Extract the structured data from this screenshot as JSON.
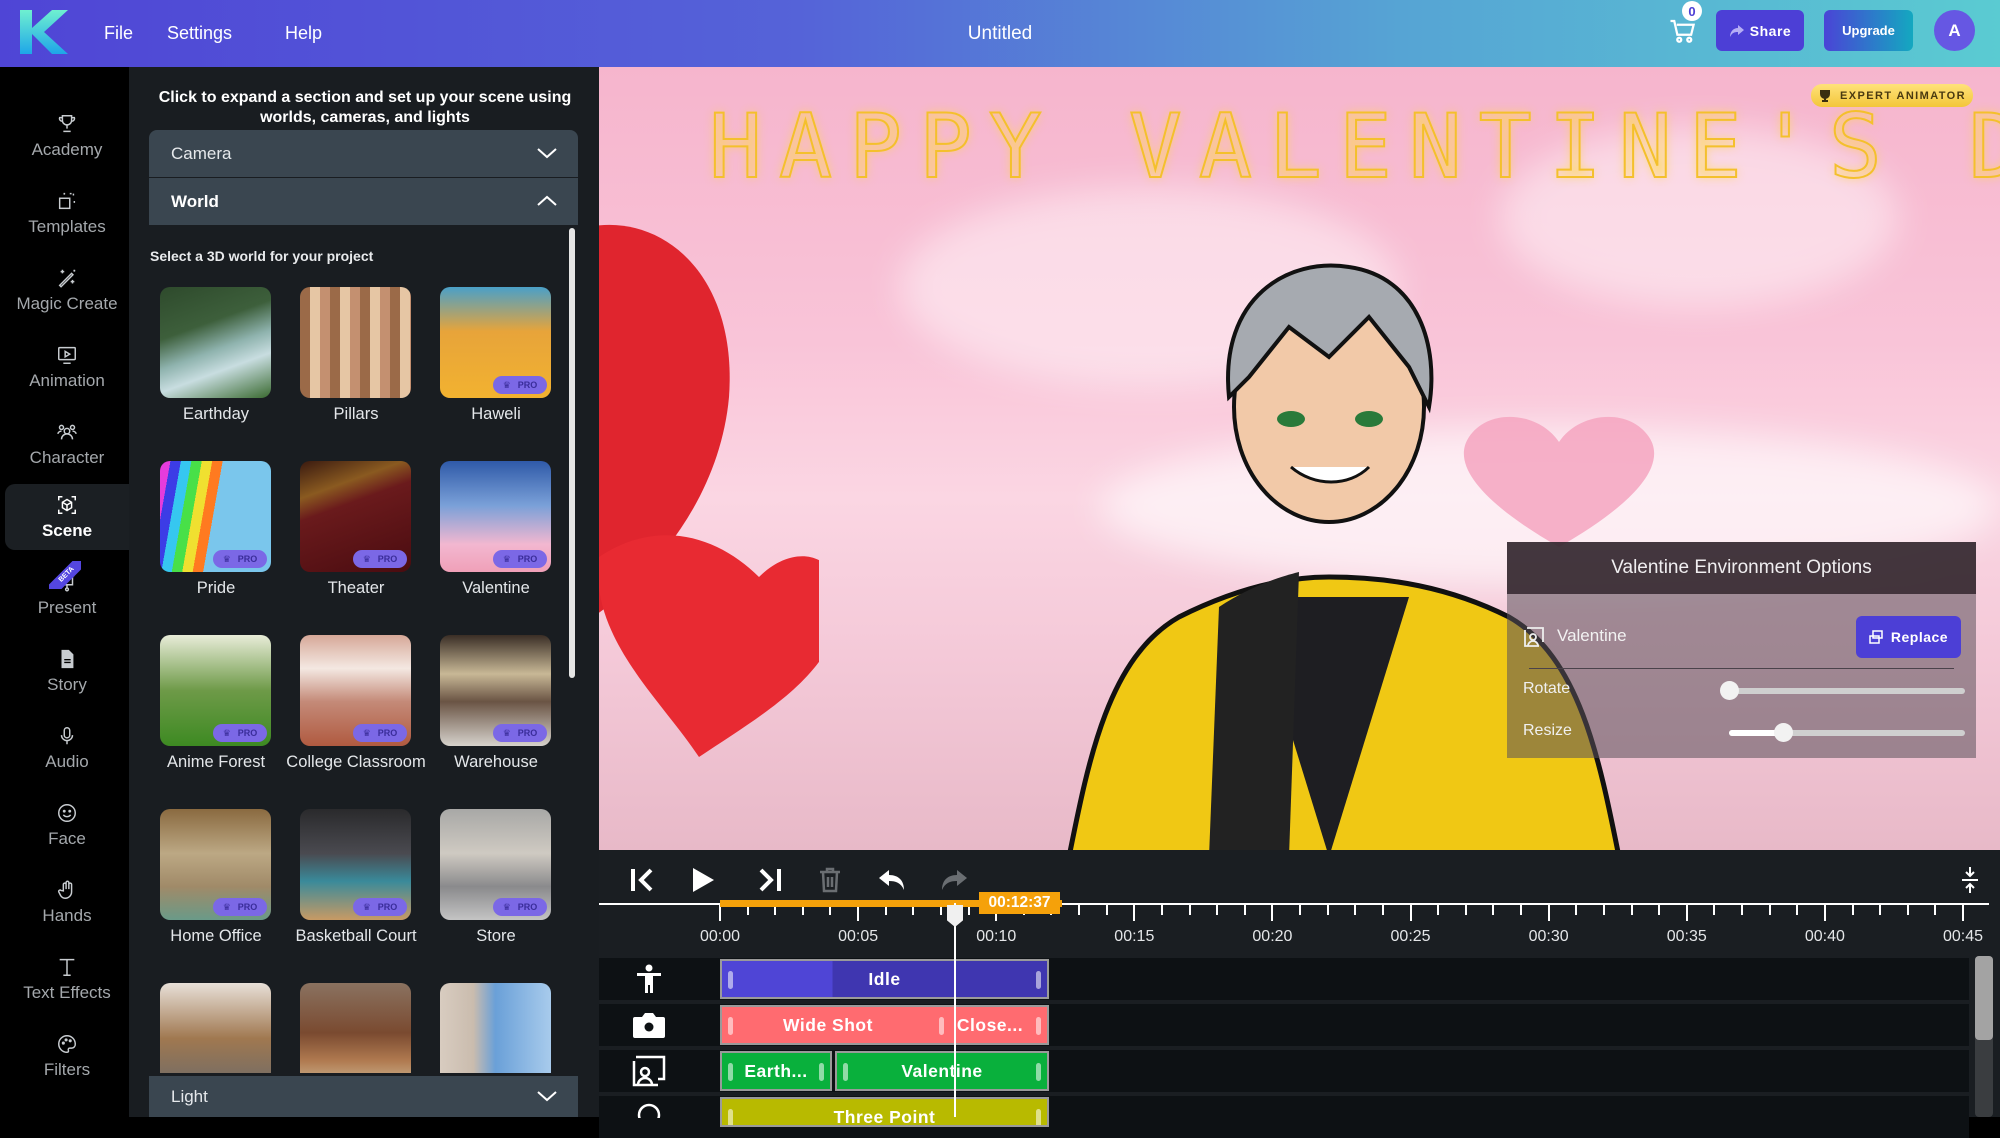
{
  "topbar": {
    "menu": [
      "File",
      "Settings",
      "Help"
    ],
    "title": "Untitled",
    "cart_count": "0",
    "share_label": "Share",
    "upgrade_label": "Upgrade",
    "avatar_initial": "A",
    "brand_color": "#4c3fd6"
  },
  "sidebar": {
    "items": [
      {
        "label": "Academy",
        "icon": "trophy-icon"
      },
      {
        "label": "Templates",
        "icon": "templates-icon"
      },
      {
        "label": "Magic Create",
        "icon": "magic-wand-icon"
      },
      {
        "label": "Animation",
        "icon": "animation-play-icon"
      },
      {
        "label": "Character",
        "icon": "characters-icon"
      },
      {
        "label": "Scene",
        "icon": "scene-cube-icon",
        "active": true
      },
      {
        "label": "Present",
        "icon": "presentation-icon",
        "badge": "BETA"
      },
      {
        "label": "Story",
        "icon": "document-icon"
      },
      {
        "label": "Audio",
        "icon": "microphone-icon"
      },
      {
        "label": "Face",
        "icon": "smiley-face-icon"
      },
      {
        "label": "Hands",
        "icon": "hand-icon"
      },
      {
        "label": "Text Effects",
        "icon": "text-icon"
      },
      {
        "label": "Filters",
        "icon": "palette-icon"
      }
    ]
  },
  "panel": {
    "hint": "Click to expand a section and set up your scene using worlds, cameras, and lights",
    "sections": {
      "camera": "Camera",
      "world": "World",
      "light": "Light"
    },
    "world_subtitle": "Select a 3D world for your project",
    "pro_label": "PRO",
    "worlds": [
      {
        "name": "Earthday",
        "pro": false
      },
      {
        "name": "Pillars",
        "pro": false
      },
      {
        "name": "Haweli",
        "pro": true
      },
      {
        "name": "Pride",
        "pro": true
      },
      {
        "name": "Theater",
        "pro": true
      },
      {
        "name": "Valentine",
        "pro": true
      },
      {
        "name": "Anime Forest",
        "pro": true
      },
      {
        "name": "College Classroom",
        "pro": true
      },
      {
        "name": "Warehouse",
        "pro": true
      },
      {
        "name": "Home Office",
        "pro": true
      },
      {
        "name": "Basketball Court",
        "pro": true
      },
      {
        "name": "Store",
        "pro": true
      },
      {
        "name": "",
        "pro": true
      },
      {
        "name": "",
        "pro": true
      },
      {
        "name": "",
        "pro": true
      }
    ]
  },
  "viewport": {
    "headline": "HAPPY VALENTINE'S DAY",
    "expert_badge": "EXPERT ANIMATOR",
    "env_options": {
      "title": "Valentine Environment Options",
      "world_name": "Valentine",
      "replace_label": "Replace",
      "rotate_label": "Rotate",
      "rotate_value": 0.0,
      "resize_label": "Resize",
      "resize_value": 0.23
    }
  },
  "timeline": {
    "current_time": "00:12:37",
    "tick_labels": [
      "00:00",
      "00:05",
      "00:10",
      "00:15",
      "00:20",
      "00:25",
      "00:30",
      "00:35",
      "00:40",
      "00:45"
    ],
    "tracks": [
      {
        "icon": "person-animation-icon",
        "clips": [
          {
            "label": "Idle",
            "color": "#4a3fd0"
          }
        ]
      },
      {
        "icon": "camera-icon",
        "clips": [
          {
            "label": "Wide Shot",
            "color": "#ff6b70"
          },
          {
            "label": "Close...",
            "color": "#ff6b70"
          }
        ]
      },
      {
        "icon": "world-scene-icon",
        "clips": [
          {
            "label": "Earth...",
            "color": "#09b03c"
          },
          {
            "label": "Valentine",
            "color": "#09b03c"
          }
        ]
      },
      {
        "icon": "light-bulb-icon",
        "clips": [
          {
            "label": "Three Point",
            "color": "#b8ba00"
          }
        ]
      }
    ]
  }
}
